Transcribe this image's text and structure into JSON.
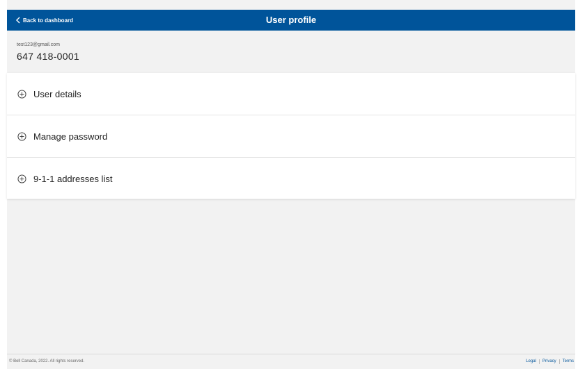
{
  "header": {
    "back_label": "Back to dashboard",
    "title": "User profile",
    "color": "#00549a"
  },
  "account": {
    "email": "test123@gmail.com",
    "phone": "647 418-0001"
  },
  "sections": [
    {
      "label": "User details",
      "icon": "plus-circle-icon"
    },
    {
      "label": "Manage password",
      "icon": "plus-circle-icon"
    },
    {
      "label": "9-1-1 addresses list",
      "icon": "plus-circle-icon"
    }
  ],
  "footer": {
    "copyright": "© Bell Canada, 2022. All rights reserved.",
    "links": [
      "Legal",
      "Privacy",
      "Terms"
    ]
  }
}
